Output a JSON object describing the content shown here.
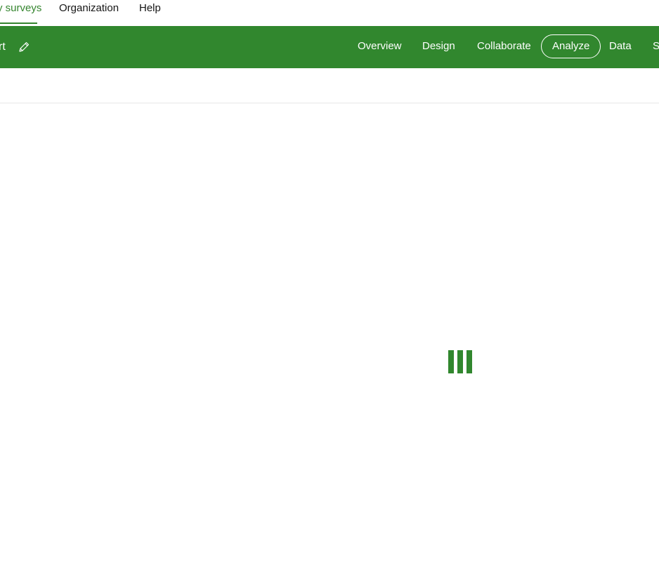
{
  "top_nav": {
    "items": [
      {
        "label": "y surveys",
        "active": true
      },
      {
        "label": "Organization",
        "active": false
      },
      {
        "label": "Help",
        "active": false
      }
    ]
  },
  "header": {
    "title_fragment": "rt",
    "tabs": [
      {
        "label": "Overview"
      },
      {
        "label": "Design"
      },
      {
        "label": "Collaborate"
      },
      {
        "label": "Analyze",
        "active": true
      },
      {
        "label": "Data"
      },
      {
        "label": "S"
      }
    ]
  },
  "colors": {
    "brand_green": "#31872e",
    "active_link_green": "#35852f"
  },
  "loader": {
    "icon": "loading-bars-icon"
  }
}
